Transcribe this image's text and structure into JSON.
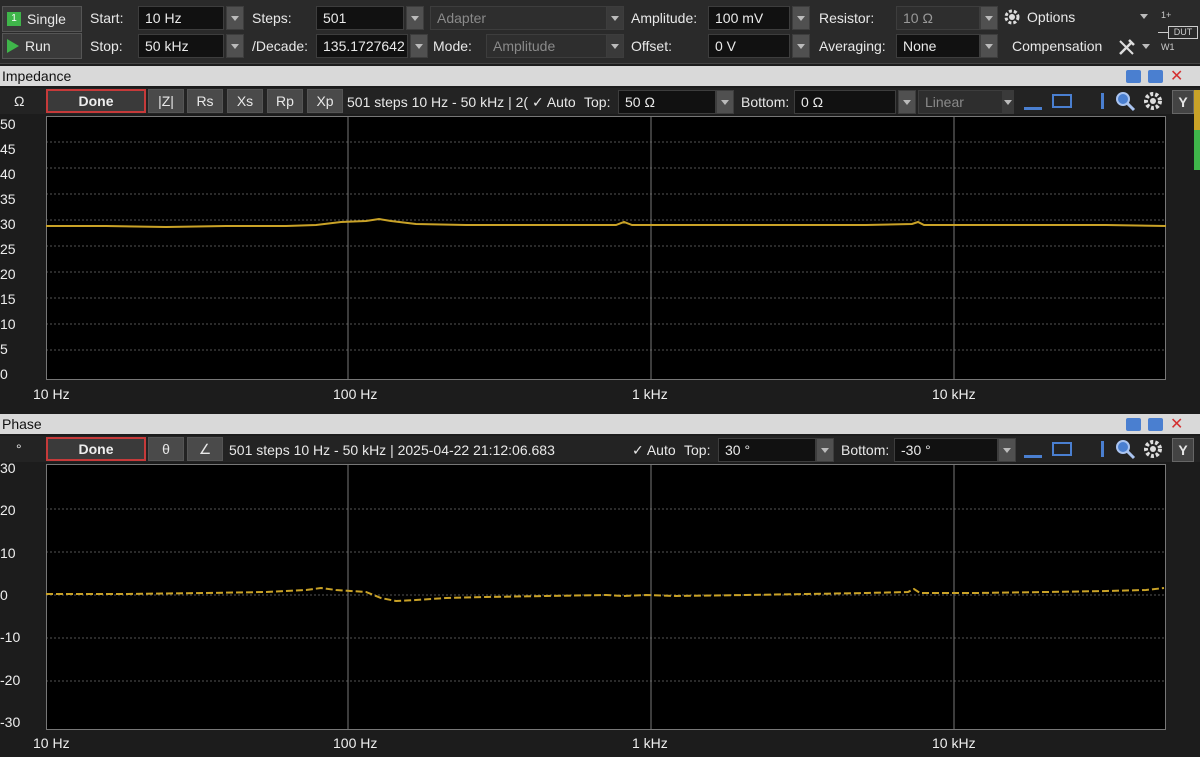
{
  "toolbar": {
    "single_label": "Single",
    "run_label": "Run",
    "start_label": "Start:",
    "start_value": "10 Hz",
    "stop_label": "Stop:",
    "stop_value": "50 kHz",
    "steps_label": "Steps:",
    "steps_value": "501",
    "per_decade_label": "/Decade:",
    "per_decade_value": "135.1727642",
    "adapter_value": "Adapter",
    "mode_label": "Mode:",
    "mode_value": "Amplitude",
    "amplitude_label": "Amplitude:",
    "amplitude_value": "100 mV",
    "offset_label": "Offset:",
    "offset_value": "0 V",
    "resistor_label": "Resistor:",
    "resistor_value": "10 Ω",
    "averaging_label": "Averaging:",
    "averaging_value": "None",
    "options_label": "Options",
    "compensation_label": "Compensation",
    "dut_label": "DUT",
    "pin_1": "1+",
    "pin_w1": "W1"
  },
  "impedance": {
    "title": "Impedance",
    "unit": "Ω",
    "done_label": "Done",
    "tabs": [
      "|Z|",
      "Rs",
      "Xs",
      "Rp",
      "Xp"
    ],
    "info": "501 steps 10 Hz - 50 kHz | 2(",
    "auto_label": "✓  Auto",
    "top_label": "Top:",
    "top_value": "50 Ω",
    "bottom_label": "Bottom:",
    "bottom_value": "0 Ω",
    "scale_value": "Linear",
    "y_button": "Y",
    "yticks": [
      "50",
      "45",
      "40",
      "35",
      "30",
      "25",
      "20",
      "15",
      "10",
      "5",
      "0"
    ],
    "xticks": [
      "10 Hz",
      "100 Hz",
      "1 kHz",
      "10 kHz"
    ]
  },
  "phase": {
    "title": "Phase",
    "unit": "°",
    "done_label": "Done",
    "tabs": [
      "θ",
      "∠"
    ],
    "info": "501 steps 10 Hz - 50 kHz | 2025-04-22 21:12:06.683",
    "auto_label": "✓  Auto",
    "top_label": "Top:",
    "top_value": "30 °",
    "bottom_label": "Bottom:",
    "bottom_value": "-30 °",
    "y_button": "Y",
    "yticks": [
      "30",
      "20",
      "10",
      "0",
      "-10",
      "-20",
      "-30"
    ],
    "xticks": [
      "10 Hz",
      "100 Hz",
      "1 kHz",
      "10 kHz"
    ]
  },
  "colors": {
    "trace": "#c9a227",
    "accent_red": "#c63a3a",
    "run_green": "#3fb54a"
  }
}
